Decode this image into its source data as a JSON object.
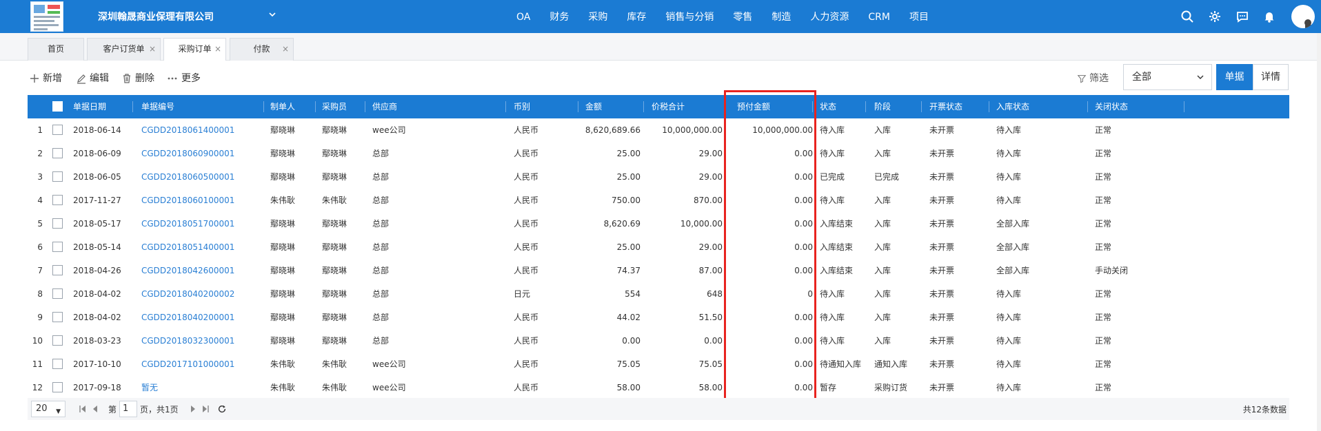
{
  "app": {
    "company": "深圳翰晟商业保理有限公司"
  },
  "nav": [
    "OA",
    "财务",
    "采购",
    "库存",
    "销售与分销",
    "零售",
    "制造",
    "人力资源",
    "CRM",
    "项目"
  ],
  "header_icons": [
    "search-icon",
    "gear-icon",
    "chat-icon",
    "bell-icon"
  ],
  "tabs": [
    {
      "label": "首页",
      "closable": false,
      "active": false
    },
    {
      "label": "客户订货单",
      "closable": true,
      "active": false
    },
    {
      "label": "采购订单",
      "closable": true,
      "active": true
    },
    {
      "label": "付款",
      "closable": true,
      "active": false
    }
  ],
  "toolbar": {
    "add": "新增",
    "edit": "编辑",
    "delete": "删除",
    "more": "更多",
    "filter": "筛选",
    "scope_value": "全部",
    "view_list": "单据",
    "view_detail": "详情"
  },
  "table": {
    "columns": [
      "单据日期",
      "单据编号",
      "制单人",
      "采购员",
      "供应商",
      "币别",
      "金额",
      "价税合计",
      "预付金额",
      "状态",
      "阶段",
      "开票状态",
      "入库状态",
      "关闭状态"
    ],
    "rows": [
      [
        "1",
        "2018-06-14",
        "CGDD2018061400001",
        "鄢晓琳",
        "鄢晓琳",
        "wee公司",
        "人民币",
        "8,620,689.66",
        "10,000,000.00",
        "10,000,000.00",
        "待入库",
        "入库",
        "未开票",
        "待入库",
        "正常"
      ],
      [
        "2",
        "2018-06-09",
        "CGDD2018060900001",
        "鄢晓琳",
        "鄢晓琳",
        "总部",
        "人民币",
        "25.00",
        "29.00",
        "0.00",
        "待入库",
        "入库",
        "未开票",
        "待入库",
        "正常"
      ],
      [
        "3",
        "2018-06-05",
        "CGDD2018060500001",
        "鄢晓琳",
        "鄢晓琳",
        "总部",
        "人民币",
        "25.00",
        "29.00",
        "0.00",
        "已完成",
        "已完成",
        "未开票",
        "待入库",
        "正常"
      ],
      [
        "4",
        "2017-11-27",
        "CGDD2018060100001",
        "朱伟耿",
        "朱伟耿",
        "总部",
        "人民币",
        "750.00",
        "870.00",
        "0.00",
        "待入库",
        "入库",
        "未开票",
        "待入库",
        "正常"
      ],
      [
        "5",
        "2018-05-17",
        "CGDD2018051700001",
        "鄢晓琳",
        "鄢晓琳",
        "总部",
        "人民币",
        "8,620.69",
        "10,000.00",
        "0.00",
        "入库结束",
        "入库",
        "未开票",
        "全部入库",
        "正常"
      ],
      [
        "6",
        "2018-05-14",
        "CGDD2018051400001",
        "鄢晓琳",
        "鄢晓琳",
        "总部",
        "人民币",
        "25.00",
        "29.00",
        "0.00",
        "入库结束",
        "入库",
        "未开票",
        "全部入库",
        "正常"
      ],
      [
        "7",
        "2018-04-26",
        "CGDD2018042600001",
        "鄢晓琳",
        "鄢晓琳",
        "总部",
        "人民币",
        "74.37",
        "87.00",
        "0.00",
        "入库结束",
        "入库",
        "未开票",
        "全部入库",
        "手动关闭"
      ],
      [
        "8",
        "2018-04-02",
        "CGDD2018040200002",
        "鄢晓琳",
        "鄢晓琳",
        "总部",
        "日元",
        "554",
        "648",
        "0",
        "待入库",
        "入库",
        "未开票",
        "待入库",
        "正常"
      ],
      [
        "9",
        "2018-04-02",
        "CGDD2018040200001",
        "鄢晓琳",
        "鄢晓琳",
        "总部",
        "人民币",
        "44.02",
        "51.50",
        "0.00",
        "待入库",
        "入库",
        "未开票",
        "待入库",
        "正常"
      ],
      [
        "10",
        "2018-03-23",
        "CGDD2018032300001",
        "鄢晓琳",
        "鄢晓琳",
        "总部",
        "人民币",
        "0.00",
        "0.00",
        "0.00",
        "待入库",
        "入库",
        "未开票",
        "待入库",
        "正常"
      ],
      [
        "11",
        "2017-10-10",
        "CGDD2017101000001",
        "朱伟耿",
        "朱伟耿",
        "wee公司",
        "人民币",
        "75.05",
        "75.05",
        "0.00",
        "待通知入库",
        "通知入库",
        "未开票",
        "待入库",
        "正常"
      ],
      [
        "12",
        "2017-09-18",
        "暂无",
        "朱伟耿",
        "朱伟耿",
        "wee公司",
        "人民币",
        "58.00",
        "58.00",
        "0.00",
        "暂存",
        "采购订货",
        "未开票",
        "待入库",
        "正常"
      ]
    ]
  },
  "pager": {
    "page_size": "20",
    "prefix": "第",
    "page": "1",
    "suffix": "页，共1页",
    "total": "共12条数据"
  },
  "colors": {
    "primary": "#1b7bd3",
    "highlight": "#e8231f",
    "link": "#2a7fd4"
  }
}
